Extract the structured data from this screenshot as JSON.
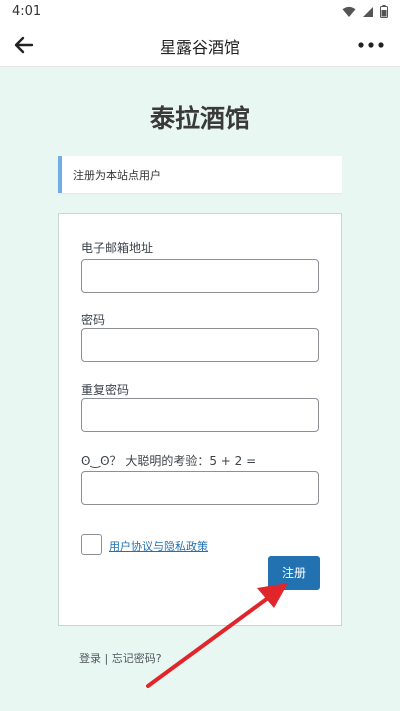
{
  "status_bar": {
    "time": "4:01",
    "icons": [
      "wifi-icon",
      "signal-icon",
      "battery-icon"
    ]
  },
  "app_bar": {
    "title": "星露谷酒馆",
    "back_icon": "arrow-left-icon",
    "more_icon": "more-vertical-dots-icon"
  },
  "page": {
    "site_title": "泰拉酒馆",
    "notice": "注册为本站点用户",
    "form": {
      "email_label": "电子邮箱地址",
      "email_value": "",
      "password_label": "密码",
      "password_value": "",
      "repeat_password_label": "重复密码",
      "repeat_password_value": "",
      "captcha_label": "ʘ‿ʘ？ 大聪明的考验：5 + 2 =",
      "captcha_value": "",
      "policy_checked": false,
      "policy_link": "用户协议与隐私政策",
      "submit_label": "注册"
    },
    "bottom_links": {
      "login": "登录",
      "separator": " | ",
      "forgot": "忘记密码?"
    }
  },
  "colors": {
    "page_background": "#e9f7f2",
    "accent": "#2271b1",
    "notice_border": "#72aee6",
    "annotation_arrow": "#e0262b"
  }
}
